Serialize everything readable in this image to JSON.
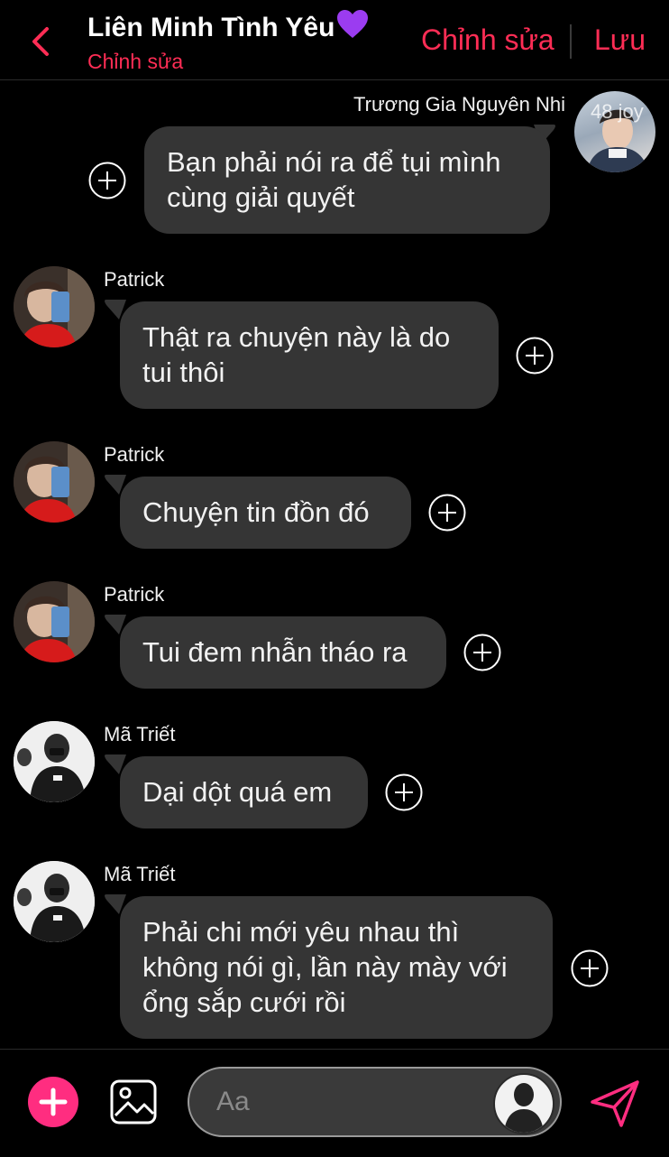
{
  "header": {
    "back_icon": "chevron-left-icon",
    "title": "Liên Minh Tình Yêu",
    "title_emoji": "purple-heart-icon",
    "subtitle": "Chỉnh sửa",
    "edit_label": "Chỉnh sửa",
    "save_label": "Lưu",
    "accent_color": "#ff2d55"
  },
  "messages": [
    {
      "sender": "Trương Gia Nguyên Nhi",
      "avatar_caption": "48 joy",
      "side": "right",
      "lines": [
        "Bạn phải nói ra để tụi mình",
        "cùng giải quyết"
      ]
    },
    {
      "sender": "Patrick",
      "side": "left",
      "lines": [
        "Thật ra chuyện này là do",
        "tui thôi"
      ]
    },
    {
      "sender": "Patrick",
      "side": "left",
      "lines": [
        "Chuyện tin đồn đó"
      ]
    },
    {
      "sender": "Patrick",
      "side": "left",
      "lines": [
        "Tui đem nhẫn tháo ra"
      ]
    },
    {
      "sender": "Mã Triết",
      "side": "left",
      "lines": [
        "Dại dột quá em"
      ]
    },
    {
      "sender": "Mã Triết",
      "side": "left",
      "lines": [
        "Phải chi mới yêu nhau thì",
        "không nói gì, lần này mày với",
        "ổng sắp cưới rồi"
      ]
    }
  ],
  "composer": {
    "add_icon": "plus-icon",
    "image_icon": "image-icon",
    "placeholder": "Aa",
    "send_icon": "send-icon",
    "fab_color": "#ff2d80"
  }
}
